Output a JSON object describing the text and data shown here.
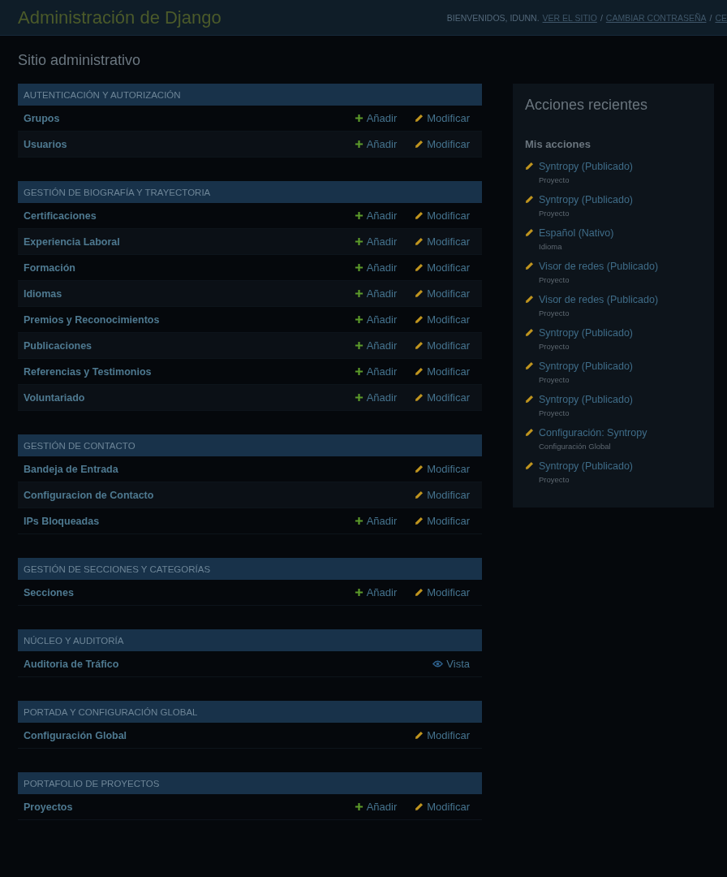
{
  "header": {
    "title": "Administración de Django",
    "welcome": "BIENVENIDOS, IDUNN.",
    "links": [
      {
        "label": "VER EL SITIO",
        "kind": "link"
      },
      {
        "label": "/",
        "kind": "sep"
      },
      {
        "label": "CAMBIAR CONTRASEÑA",
        "kind": "link"
      },
      {
        "label": "/",
        "kind": "sep"
      },
      {
        "label": "CE",
        "kind": "link"
      }
    ]
  },
  "page_title": "Sitio administrativo",
  "apps": [
    {
      "caption": "AUTENTICACIÓN Y AUTORIZACIÓN",
      "models": [
        {
          "name": "Grupos",
          "actions": [
            {
              "kind": "add",
              "label": "Añadir"
            },
            {
              "kind": "change",
              "label": "Modificar"
            }
          ]
        },
        {
          "name": "Usuarios",
          "actions": [
            {
              "kind": "add",
              "label": "Añadir"
            },
            {
              "kind": "change",
              "label": "Modificar"
            }
          ]
        }
      ]
    },
    {
      "caption": "GESTIÓN DE BIOGRAFÍA Y TRAYECTORIA",
      "models": [
        {
          "name": "Certificaciones",
          "actions": [
            {
              "kind": "add",
              "label": "Añadir"
            },
            {
              "kind": "change",
              "label": "Modificar"
            }
          ]
        },
        {
          "name": "Experiencia Laboral",
          "actions": [
            {
              "kind": "add",
              "label": "Añadir"
            },
            {
              "kind": "change",
              "label": "Modificar"
            }
          ]
        },
        {
          "name": "Formación",
          "actions": [
            {
              "kind": "add",
              "label": "Añadir"
            },
            {
              "kind": "change",
              "label": "Modificar"
            }
          ]
        },
        {
          "name": "Idiomas",
          "actions": [
            {
              "kind": "add",
              "label": "Añadir"
            },
            {
              "kind": "change",
              "label": "Modificar"
            }
          ]
        },
        {
          "name": "Premios y Reconocimientos",
          "actions": [
            {
              "kind": "add",
              "label": "Añadir"
            },
            {
              "kind": "change",
              "label": "Modificar"
            }
          ]
        },
        {
          "name": "Publicaciones",
          "actions": [
            {
              "kind": "add",
              "label": "Añadir"
            },
            {
              "kind": "change",
              "label": "Modificar"
            }
          ]
        },
        {
          "name": "Referencias y Testimonios",
          "actions": [
            {
              "kind": "add",
              "label": "Añadir"
            },
            {
              "kind": "change",
              "label": "Modificar"
            }
          ]
        },
        {
          "name": "Voluntariado",
          "actions": [
            {
              "kind": "add",
              "label": "Añadir"
            },
            {
              "kind": "change",
              "label": "Modificar"
            }
          ]
        }
      ]
    },
    {
      "caption": "GESTIÓN DE CONTACTO",
      "models": [
        {
          "name": "Bandeja de Entrada",
          "actions": [
            {
              "kind": "change",
              "label": "Modificar"
            }
          ]
        },
        {
          "name": "Configuracion de Contacto",
          "actions": [
            {
              "kind": "change",
              "label": "Modificar"
            }
          ]
        },
        {
          "name": "IPs Bloqueadas",
          "actions": [
            {
              "kind": "add",
              "label": "Añadir"
            },
            {
              "kind": "change",
              "label": "Modificar"
            }
          ]
        }
      ]
    },
    {
      "caption": "GESTIÓN DE SECCIONES Y CATEGORÍAS",
      "models": [
        {
          "name": "Secciones",
          "actions": [
            {
              "kind": "add",
              "label": "Añadir"
            },
            {
              "kind": "change",
              "label": "Modificar"
            }
          ]
        }
      ]
    },
    {
      "caption": "NÚCLEO Y AUDITORÍA",
      "models": [
        {
          "name": "Auditoria de Tráfico",
          "actions": [
            {
              "kind": "view",
              "label": "Vista"
            }
          ]
        }
      ]
    },
    {
      "caption": "PORTADA Y CONFIGURACIÓN GLOBAL",
      "models": [
        {
          "name": "Configuración Global",
          "actions": [
            {
              "kind": "change",
              "label": "Modificar"
            }
          ]
        }
      ]
    },
    {
      "caption": "PORTAFOLIO DE PROYECTOS",
      "models": [
        {
          "name": "Proyectos",
          "actions": [
            {
              "kind": "add",
              "label": "Añadir"
            },
            {
              "kind": "change",
              "label": "Modificar"
            }
          ]
        }
      ]
    }
  ],
  "recent": {
    "title": "Acciones recientes",
    "subtitle": "Mis acciones",
    "items": [
      {
        "label": "Syntropy (Publicado)",
        "type": "Proyecto"
      },
      {
        "label": "Syntropy (Publicado)",
        "type": "Proyecto"
      },
      {
        "label": "Español (Nativo)",
        "type": "Idioma"
      },
      {
        "label": "Visor de redes (Publicado)",
        "type": "Proyecto"
      },
      {
        "label": "Visor de redes (Publicado)",
        "type": "Proyecto"
      },
      {
        "label": "Syntropy (Publicado)",
        "type": "Proyecto"
      },
      {
        "label": "Syntropy (Publicado)",
        "type": "Proyecto"
      },
      {
        "label": "Syntropy (Publicado)",
        "type": "Proyecto"
      },
      {
        "label": "Configuración: Syntropy",
        "type": "Configuración Global"
      },
      {
        "label": "Syntropy (Publicado)",
        "type": "Proyecto"
      }
    ]
  }
}
